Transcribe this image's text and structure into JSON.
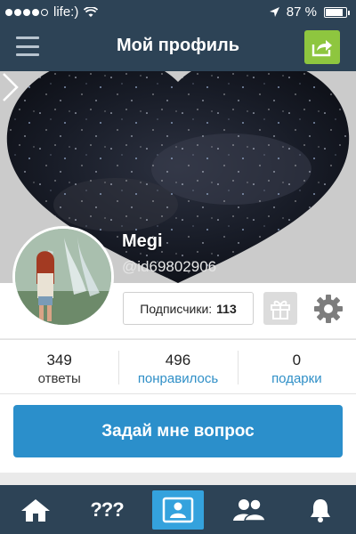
{
  "status_bar": {
    "carrier": "life:)",
    "battery": "87 %",
    "battery_level": 0.87
  },
  "nav": {
    "title": "Мой профиль"
  },
  "profile": {
    "name": "Megi",
    "id": "@id69802906",
    "followers_label": "Подписчики:",
    "followers_count": "113"
  },
  "stats": [
    {
      "value": "349",
      "label": "ответы"
    },
    {
      "value": "496",
      "label": "понравилось"
    },
    {
      "value": "0",
      "label": "подарки"
    }
  ],
  "ask_button": "Задай мне вопрос",
  "tabs": {
    "questions_label": "???"
  },
  "colors": {
    "nav_bg": "#2d4356",
    "accent": "#2b8fcb",
    "share": "#8ec63f"
  }
}
